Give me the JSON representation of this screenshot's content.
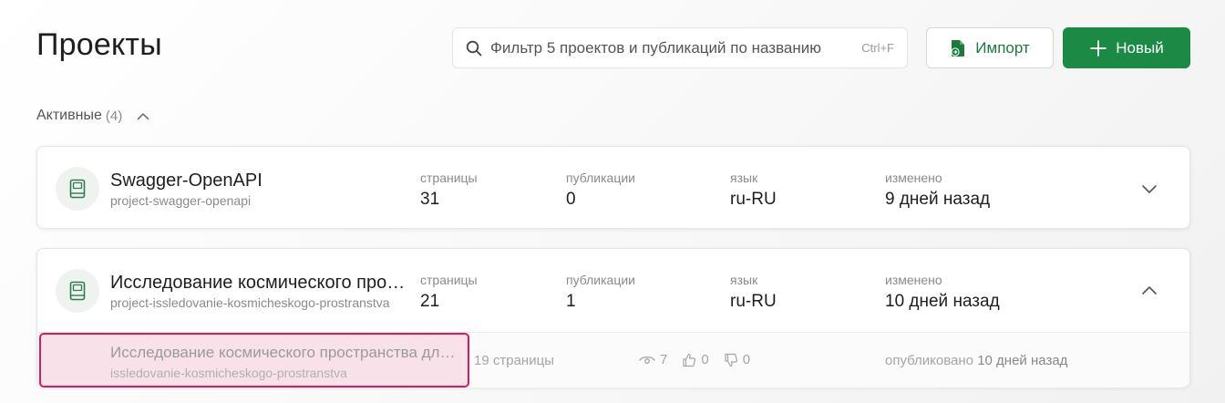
{
  "page": {
    "title": "Проекты"
  },
  "search": {
    "placeholder": "Фильтр 5 проектов и публикаций по названию",
    "shortcut": "Ctrl+F"
  },
  "toolbar": {
    "import_label": "Импорт",
    "new_label": "Новый"
  },
  "section": {
    "label": "Активные",
    "count": "(4)"
  },
  "columns": {
    "pages": "страницы",
    "publications": "публикации",
    "language": "язык",
    "modified": "изменено"
  },
  "projects": [
    {
      "name": "Swagger-OpenAPI",
      "slug": "project-swagger-openapi",
      "pages": "31",
      "publications": "0",
      "language": "ru-RU",
      "modified": "9 дней назад",
      "expanded": false
    },
    {
      "name": "Исследование космического пространства",
      "slug": "project-issledovanie-kosmicheskogo-prostranstva",
      "pages": "21",
      "publications": "1",
      "language": "ru-RU",
      "modified": "10 дней назад",
      "expanded": true,
      "publication": {
        "name": "Исследование космического пространства для начинающих",
        "slug": "issledovanie-kosmicheskogo-prostranstva",
        "pages": "19 страницы",
        "views": "7",
        "likes": "0",
        "dislikes": "0",
        "published_label": "опубликовано",
        "published_when": "10 дней назад"
      }
    }
  ],
  "colors": {
    "brand": "#1a8a44",
    "highlight_border": "#d81b60",
    "highlight_fill": "#f9e1ea"
  }
}
